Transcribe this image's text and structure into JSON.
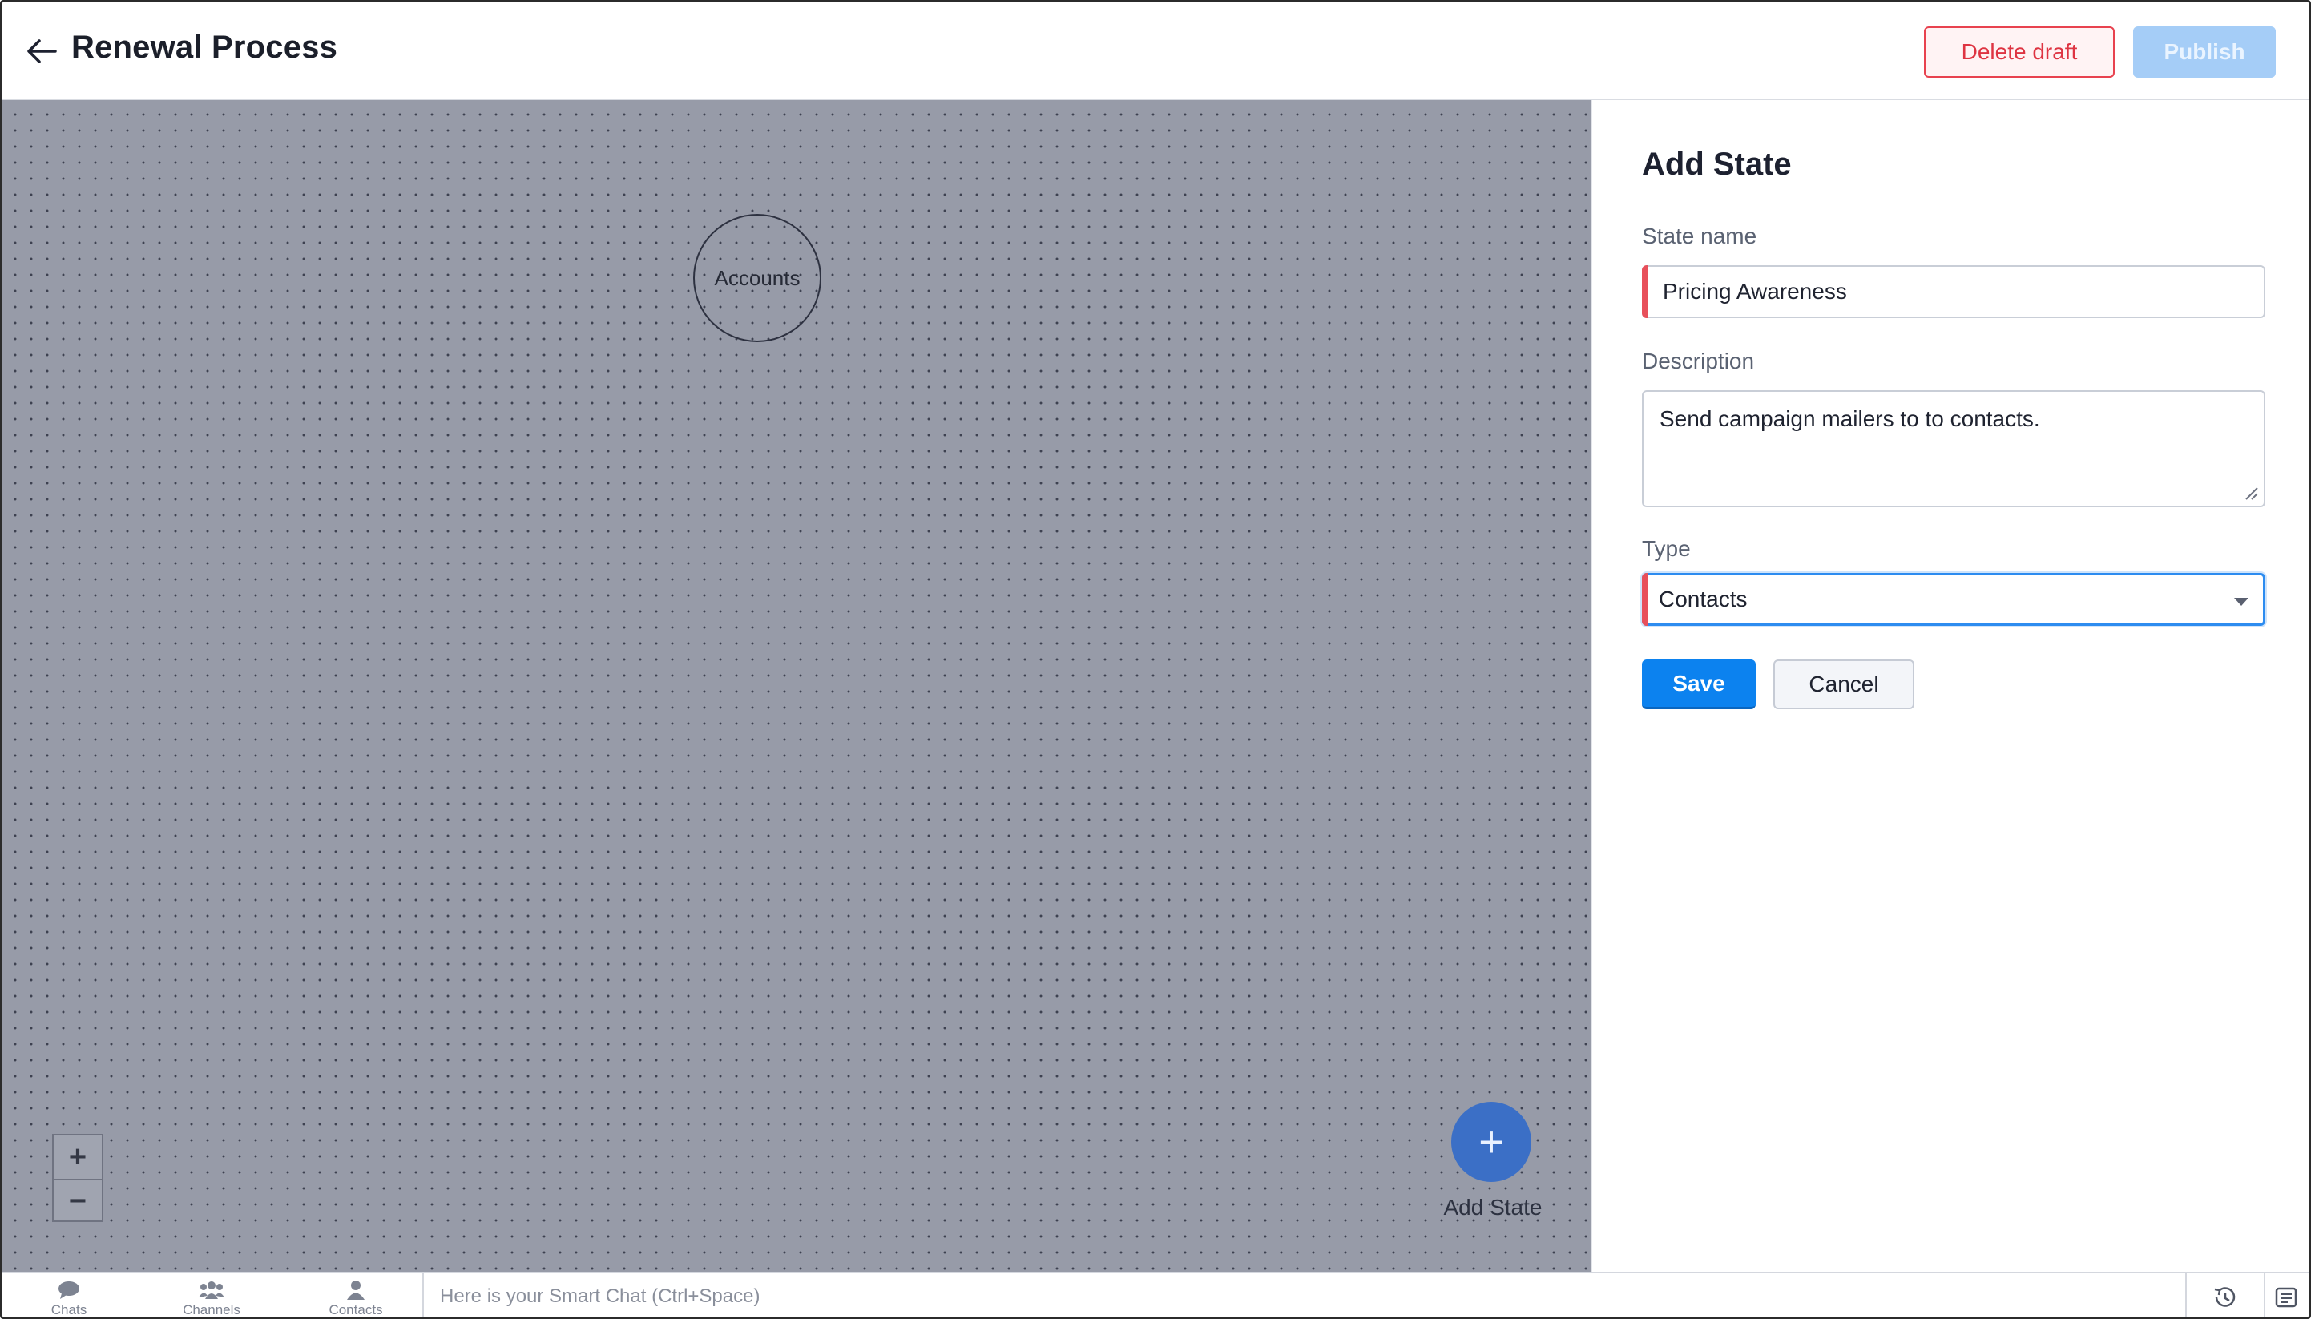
{
  "header": {
    "title": "Renewal Process",
    "delete_label": "Delete draft",
    "publish_label": "Publish"
  },
  "canvas": {
    "node_label": "Accounts",
    "zoom_in": "+",
    "zoom_out": "−",
    "add_state_icon": "+",
    "add_state_label": "Add State"
  },
  "panel": {
    "title": "Add State",
    "state_name_label": "State name",
    "state_name_value": "Pricing Awareness",
    "description_label": "Description",
    "description_value": "Send campaign mailers to to contacts.",
    "type_label": "Type",
    "type_value": "Contacts",
    "save_label": "Save",
    "cancel_label": "Cancel"
  },
  "bottombar": {
    "nav": [
      {
        "label": "Chats",
        "icon": "chat-bubble-icon"
      },
      {
        "label": "Channels",
        "icon": "group-icon"
      },
      {
        "label": "Contacts",
        "icon": "person-icon"
      }
    ],
    "smart_chat_placeholder": "Here is your Smart Chat (Ctrl+Space)"
  },
  "colors": {
    "accent": "#0c82ef",
    "danger": "#de3442",
    "canvas": "#979ba8",
    "fab": "#3b6fc6"
  }
}
